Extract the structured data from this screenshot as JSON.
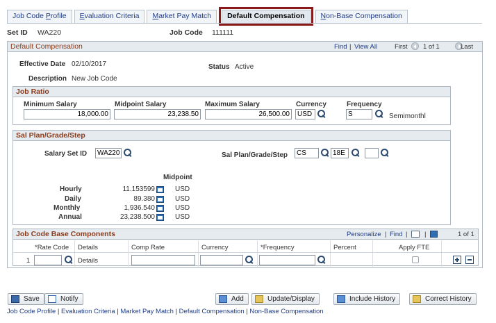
{
  "tabs": [
    {
      "label": "Job Code ",
      "ul": "P",
      "rest": "rofile"
    },
    {
      "label": "",
      "ul": "E",
      "rest": "valuation Criteria"
    },
    {
      "label": "",
      "ul": "M",
      "rest": "arket Pay Match"
    },
    {
      "label": "Default Compensation",
      "ul": "",
      "rest": ""
    },
    {
      "label": "",
      "ul": "N",
      "rest": "on-Base Compensation"
    }
  ],
  "header": {
    "setid_label": "Set ID",
    "setid_value": "WA220",
    "jobcode_label": "Job Code",
    "jobcode_value": "111111"
  },
  "panel": {
    "title": "Default Compensation",
    "find": "Find",
    "sep": "|",
    "viewall": "View All",
    "first": "First",
    "count": "1 of 1",
    "last": "Last"
  },
  "details": {
    "effdate_label": "Effective Date",
    "effdate_value": "02/10/2017",
    "status_label": "Status",
    "status_value": "Active",
    "desc_label": "Description",
    "desc_value": "New Job Code"
  },
  "job_ratio": {
    "title": "Job Ratio",
    "min_label": "Minimum Salary",
    "min_value": "18,000.00",
    "mid_label": "Midpoint Salary",
    "mid_value": "23,238.50",
    "max_label": "Maximum Salary",
    "max_value": "26,500.00",
    "cur_label": "Currency",
    "cur_value": "USD",
    "freq_label": "Frequency",
    "freq_value": "S",
    "freq_desc": "Semimonthl"
  },
  "sal_plan": {
    "title": "Sal Plan/Grade/Step",
    "setid_label": "Salary Set ID",
    "setid_value": "WA220",
    "plan_label": "Sal Plan/Grade/Step",
    "plan_value": "CS",
    "grade_value": "18E",
    "step_value": "",
    "midpoint_label": "Midpoint",
    "rows": [
      {
        "label": "Hourly",
        "value": "11.153599",
        "cur": "USD"
      },
      {
        "label": "Daily",
        "value": "89.380",
        "cur": "USD"
      },
      {
        "label": "Monthly",
        "value": "1,936.540",
        "cur": "USD"
      },
      {
        "label": "Annual",
        "value": "23,238.500",
        "cur": "USD"
      }
    ]
  },
  "components": {
    "title": "Job Code Base Components",
    "personalize": "Personalize",
    "sep": "|",
    "find": "Find",
    "count": "1 of 1",
    "columns": [
      "*Rate Code",
      "Details",
      "Comp Rate",
      "Currency",
      "*Frequency",
      "Percent",
      "Apply FTE"
    ],
    "row_num": "1",
    "details_link": "Details"
  },
  "buttons": {
    "save": "Save",
    "notify": "Notify",
    "add": "Add",
    "update": "Update/Display",
    "include": "Include History",
    "correct": "Correct History"
  },
  "bottom_links": [
    "Job Code Profile",
    "Evaluation Criteria",
    "Market Pay Match",
    "Default Compensation",
    "Non-Base Compensation"
  ],
  "bottom_sep": "|"
}
